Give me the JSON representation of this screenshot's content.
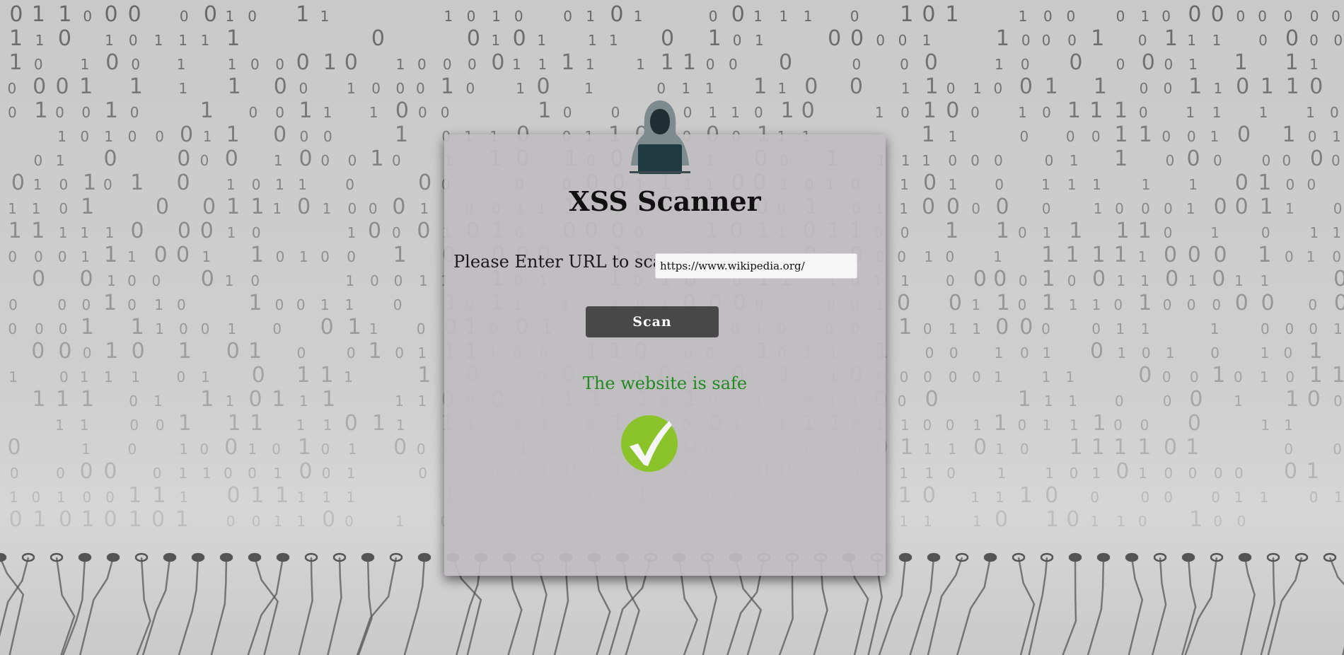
{
  "app": {
    "title": "XSS Scanner",
    "avatar_icon": "hacker-hoodie-laptop-icon"
  },
  "form": {
    "label": "Please Enter URL to scan:",
    "url_value": "https://www.wikipedia.org/",
    "scan_label": "Scan"
  },
  "result": {
    "message": "The website is safe",
    "status_icon": "green-checkmark-icon",
    "colors": {
      "text": "#1f8a1f",
      "icon_bg": "#8ac42a"
    }
  },
  "background": {
    "theme": "binary-code-and-circuit-board",
    "colors": {
      "base": "#cccccc",
      "ink": "#555555"
    }
  }
}
